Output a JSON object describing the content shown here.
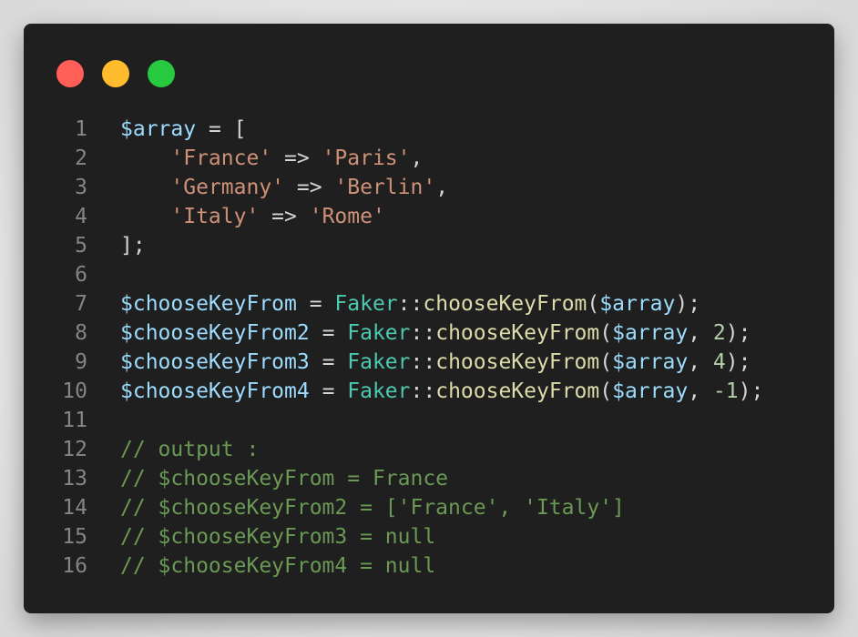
{
  "window": {
    "controls": [
      {
        "name": "close",
        "color": "#ff5f56"
      },
      {
        "name": "minimize",
        "color": "#ffbd2e"
      },
      {
        "name": "maximize",
        "color": "#27c93f"
      }
    ]
  },
  "theme": {
    "background": "#1f1f1f",
    "variable": "#9cdcfe",
    "string": "#ce9178",
    "class": "#4ec9b0",
    "function": "#dcdcaa",
    "number": "#b5cea8",
    "comment": "#6a9955",
    "punctuation": "#d4d4d4",
    "line_number": "#858585"
  },
  "code": {
    "lines": [
      {
        "n": "1",
        "tokens": [
          [
            "var",
            "$array"
          ],
          [
            "pun",
            " = ["
          ]
        ]
      },
      {
        "n": "2",
        "tokens": [
          [
            "pun",
            "    "
          ],
          [
            "str",
            "'France'"
          ],
          [
            "pun",
            " => "
          ],
          [
            "str",
            "'Paris'"
          ],
          [
            "pun",
            ","
          ]
        ]
      },
      {
        "n": "3",
        "tokens": [
          [
            "pun",
            "    "
          ],
          [
            "str",
            "'Germany'"
          ],
          [
            "pun",
            " => "
          ],
          [
            "str",
            "'Berlin'"
          ],
          [
            "pun",
            ","
          ]
        ]
      },
      {
        "n": "4",
        "tokens": [
          [
            "pun",
            "    "
          ],
          [
            "str",
            "'Italy'"
          ],
          [
            "pun",
            " => "
          ],
          [
            "str",
            "'Rome'"
          ]
        ]
      },
      {
        "n": "5",
        "tokens": [
          [
            "pun",
            "];"
          ]
        ]
      },
      {
        "n": "6",
        "tokens": []
      },
      {
        "n": "7",
        "tokens": [
          [
            "var",
            "$chooseKeyFrom"
          ],
          [
            "pun",
            " = "
          ],
          [
            "cls",
            "Faker"
          ],
          [
            "pun",
            "::"
          ],
          [
            "fn",
            "chooseKeyFrom"
          ],
          [
            "pun",
            "("
          ],
          [
            "var",
            "$array"
          ],
          [
            "pun",
            ");"
          ]
        ]
      },
      {
        "n": "8",
        "tokens": [
          [
            "var",
            "$chooseKeyFrom2"
          ],
          [
            "pun",
            " = "
          ],
          [
            "cls",
            "Faker"
          ],
          [
            "pun",
            "::"
          ],
          [
            "fn",
            "chooseKeyFrom"
          ],
          [
            "pun",
            "("
          ],
          [
            "var",
            "$array"
          ],
          [
            "pun",
            ", "
          ],
          [
            "num",
            "2"
          ],
          [
            "pun",
            ");"
          ]
        ]
      },
      {
        "n": "9",
        "tokens": [
          [
            "var",
            "$chooseKeyFrom3"
          ],
          [
            "pun",
            " = "
          ],
          [
            "cls",
            "Faker"
          ],
          [
            "pun",
            "::"
          ],
          [
            "fn",
            "chooseKeyFrom"
          ],
          [
            "pun",
            "("
          ],
          [
            "var",
            "$array"
          ],
          [
            "pun",
            ", "
          ],
          [
            "num",
            "4"
          ],
          [
            "pun",
            ");"
          ]
        ]
      },
      {
        "n": "10",
        "tokens": [
          [
            "var",
            "$chooseKeyFrom4"
          ],
          [
            "pun",
            " = "
          ],
          [
            "cls",
            "Faker"
          ],
          [
            "pun",
            "::"
          ],
          [
            "fn",
            "chooseKeyFrom"
          ],
          [
            "pun",
            "("
          ],
          [
            "var",
            "$array"
          ],
          [
            "pun",
            ", "
          ],
          [
            "num",
            "-1"
          ],
          [
            "pun",
            ");"
          ]
        ]
      },
      {
        "n": "11",
        "tokens": []
      },
      {
        "n": "12",
        "tokens": [
          [
            "cmt",
            "// output :"
          ]
        ]
      },
      {
        "n": "13",
        "tokens": [
          [
            "cmt",
            "// $chooseKeyFrom = France"
          ]
        ]
      },
      {
        "n": "14",
        "tokens": [
          [
            "cmt",
            "// $chooseKeyFrom2 = ['France', 'Italy']"
          ]
        ]
      },
      {
        "n": "15",
        "tokens": [
          [
            "cmt",
            "// $chooseKeyFrom3 = null"
          ]
        ]
      },
      {
        "n": "16",
        "tokens": [
          [
            "cmt",
            "// $chooseKeyFrom4 = null"
          ]
        ]
      }
    ]
  }
}
